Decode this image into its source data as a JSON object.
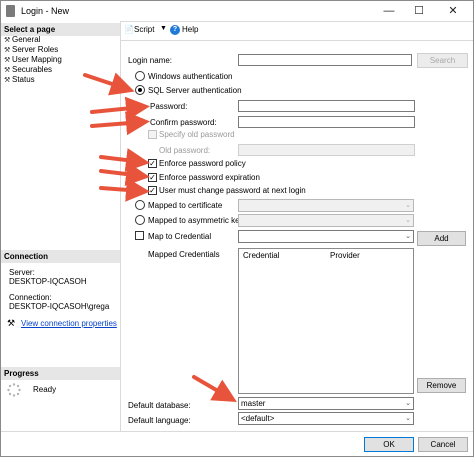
{
  "window": {
    "title": "Login - New",
    "minimize": "—",
    "maximize": "☐",
    "close": "✕"
  },
  "left": {
    "select_page_header": "Select a page",
    "pages": [
      "General",
      "Server Roles",
      "User Mapping",
      "Securables",
      "Status"
    ],
    "connection_header": "Connection",
    "server_label": "Server:",
    "server_value": "DESKTOP-IQCASOH",
    "connection_label": "Connection:",
    "connection_value": "DESKTOP-IQCASOH\\grega",
    "view_link": "View connection properties",
    "progress_header": "Progress",
    "progress_status": "Ready"
  },
  "toolbar": {
    "script": "Script",
    "help": "Help"
  },
  "form": {
    "login_name": "Login name:",
    "search": "Search",
    "windows_auth": "Windows authentication",
    "sql_auth": "SQL Server authentication",
    "password": "Password:",
    "confirm_password": "Confirm password:",
    "specify_old": "Specify old password",
    "old_password": "Old password:",
    "enforce_policy": "Enforce password policy",
    "enforce_expiration": "Enforce password expiration",
    "must_change": "User must change password at next login",
    "mapped_cert": "Mapped to certificate",
    "mapped_asym": "Mapped to asymmetric key",
    "map_credential": "Map to Credential",
    "add": "Add",
    "mapped_credentials": "Mapped Credentials",
    "col_credential": "Credential",
    "col_provider": "Provider",
    "remove": "Remove",
    "default_db_label": "Default database:",
    "default_db_value": "master",
    "default_lang_label": "Default language:",
    "default_lang_value": "<default>"
  },
  "footer": {
    "ok": "OK",
    "cancel": "Cancel"
  },
  "colors": {
    "arrow": "#e8533b",
    "link": "#0645c8",
    "ok_border": "#0078d7"
  }
}
